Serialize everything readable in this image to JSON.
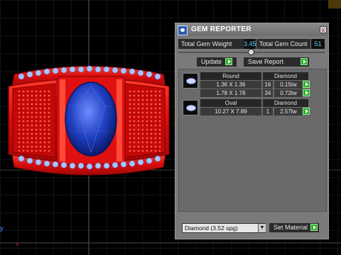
{
  "panel": {
    "title": "GEM REPORTER",
    "close_label": "x",
    "total_weight_label": "Total Gem Weight",
    "total_weight_value": "3.45",
    "total_count_label": "Total Gem Count",
    "total_count_value": "51",
    "update_label": "Update",
    "save_report_label": "Save Report",
    "groups": [
      {
        "shape": "Round",
        "material": "Diamond",
        "rows": [
          {
            "size": "1.36 X 1.36",
            "count": "16",
            "weight": "0.15tw"
          },
          {
            "size": "1.78 X 1.78",
            "count": "34",
            "weight": "0.72tw"
          }
        ]
      },
      {
        "shape": "Oval",
        "material": "Diamond",
        "rows": [
          {
            "size": "10.27 X 7.89",
            "count": "1",
            "weight": "2.57tw"
          }
        ]
      }
    ],
    "material_select": "Diamond     (3.52 spg)",
    "set_material_label": "Set Material"
  },
  "colors": {
    "ring_metal": "#e21010",
    "center_stone": "#1f3fc0",
    "accent_stones": "#a8c4ff",
    "grid_line": "#1c2a3c",
    "value_text": "#5cd0ff",
    "go_button": "#2cae2c"
  },
  "viewport": {
    "axis_label": "y"
  }
}
